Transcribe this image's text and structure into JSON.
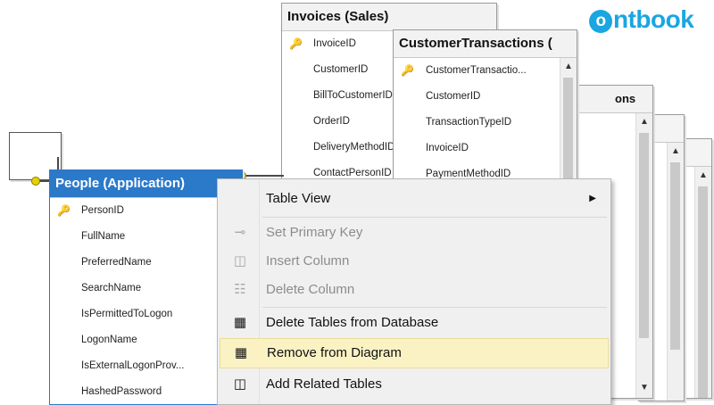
{
  "logo": {
    "mark": "o",
    "text": "ntbook"
  },
  "tables": {
    "invoices": {
      "title": "Invoices (Sales)",
      "fields": [
        "InvoiceID",
        "CustomerID",
        "BillToCustomerID",
        "OrderID",
        "DeliveryMethodID",
        "ContactPersonID"
      ]
    },
    "customer_transactions": {
      "title": "CustomerTransactions (",
      "fields": [
        "CustomerTransactio...",
        "CustomerID",
        "TransactionTypeID",
        "InvoiceID",
        "PaymentMethodID"
      ]
    },
    "back1": {
      "title": "ons"
    },
    "people": {
      "title": "People (Application)",
      "fields": [
        "PersonID",
        "FullName",
        "PreferredName",
        "SearchName",
        "IsPermittedToLogon",
        "LogonName",
        "IsExternalLogonProv...",
        "HashedPassword"
      ]
    }
  },
  "context_menu": {
    "items": [
      {
        "label": "Table View",
        "icon": "none",
        "state": "enabled",
        "submenu": true
      },
      {
        "label": "Set Primary Key",
        "icon": "key-icon",
        "state": "disabled"
      },
      {
        "label": "Insert Column",
        "icon": "insert-column-icon",
        "state": "disabled"
      },
      {
        "label": "Delete Column",
        "icon": "delete-column-icon",
        "state": "disabled"
      },
      {
        "label": "Delete Tables from Database",
        "icon": "delete-table-icon",
        "state": "enabled"
      },
      {
        "label": "Remove from Diagram",
        "icon": "remove-table-icon",
        "state": "highlighted"
      },
      {
        "label": "Add Related Tables",
        "icon": "add-related-icon",
        "state": "enabled"
      }
    ]
  },
  "colors": {
    "accent": "#2b79c9",
    "highlight": "#fbf2c4",
    "logo": "#1aa6e0",
    "key": "#c9a100"
  }
}
